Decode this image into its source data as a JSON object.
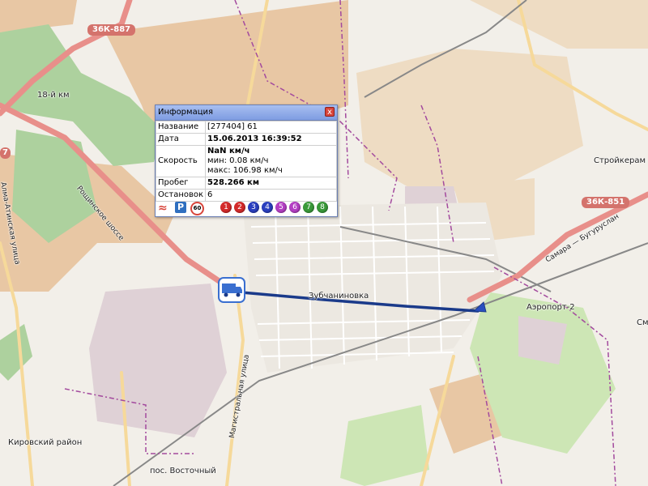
{
  "map": {
    "labels": {
      "road_36k887": "36К-887",
      "place_18km": "18-й км",
      "road_rosh": "Рощинское шоссе",
      "road_alma_ata": "Алма-Атинская улица",
      "place_stroykeram": "Стройкерам",
      "road_36k851": "36К-851",
      "road_samara": "Самара — Бугуруслан",
      "place_zubchaninovka": "Зубчаниновка",
      "place_airport2": "Аэропорт-2",
      "place_sm": "См",
      "road_magistral": "Магистральная улица",
      "place_kirovsky": "Кировский район",
      "place_vostochny": "пос. Восточный",
      "shield_left": "7"
    },
    "colors": {
      "background": "#f2efe9",
      "residential_tan": "#e8c7a4",
      "forest": "#add19e",
      "road_main": "#e88f8a",
      "road_secondary": "#f6d99a",
      "industrial": "#dfd1d6",
      "track": "#1a3a8a",
      "boundary": "#a34a9e"
    }
  },
  "popup": {
    "title": "Информация",
    "close_label": "x",
    "rows": {
      "name_key": "Название",
      "name_val": "[277404] 61",
      "date_key": "Дата",
      "date_val": "15.06.2013 16:39:52",
      "speed_key": "Скорость",
      "speed_val": "NaN км/ч",
      "speed_min": "мин: 0.08 км/ч",
      "speed_max": "макс: 106.98 км/ч",
      "mileage_key": "Пробег",
      "mileage_val": "528.266 км",
      "stops_key": "Остановок",
      "stops_val": "6"
    },
    "icons": {
      "parking_label": "P",
      "speed_limit_label": "60",
      "stops": [
        {
          "label": "1",
          "color": "#d42a2a"
        },
        {
          "label": "2",
          "color": "#d42a2a"
        },
        {
          "label": "3",
          "color": "#2a3fbf"
        },
        {
          "label": "4",
          "color": "#2a3fbf"
        },
        {
          "label": "5",
          "color": "#b43fc4"
        },
        {
          "label": "6",
          "color": "#b43fc4"
        },
        {
          "label": "7",
          "color": "#3a9a3a"
        },
        {
          "label": "8",
          "color": "#3a9a3a"
        }
      ]
    }
  }
}
